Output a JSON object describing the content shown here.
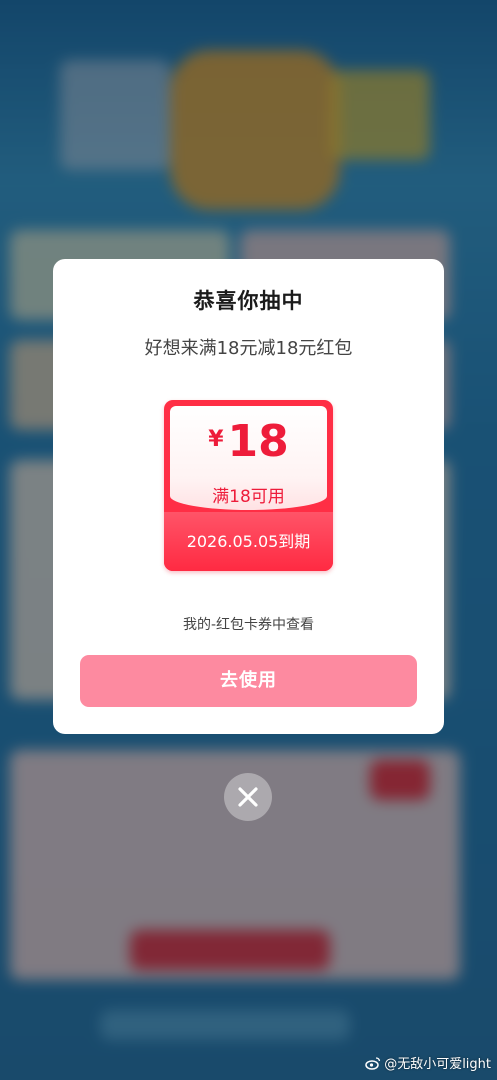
{
  "dialog": {
    "title": "恭喜你抽中",
    "subtitle": "好想来满18元减18元红包",
    "coupon": {
      "currency": "¥",
      "amount": "18",
      "condition": "满18可用",
      "expiry": "2026.05.05到期"
    },
    "hint": "我的-红包卡券中查看",
    "use_button": "去使用",
    "close_icon": "close-icon"
  },
  "watermark": "@无敌小可爱light",
  "colors": {
    "coupon_red": "#ff2e45",
    "button_pink": "#fd8aa0"
  }
}
